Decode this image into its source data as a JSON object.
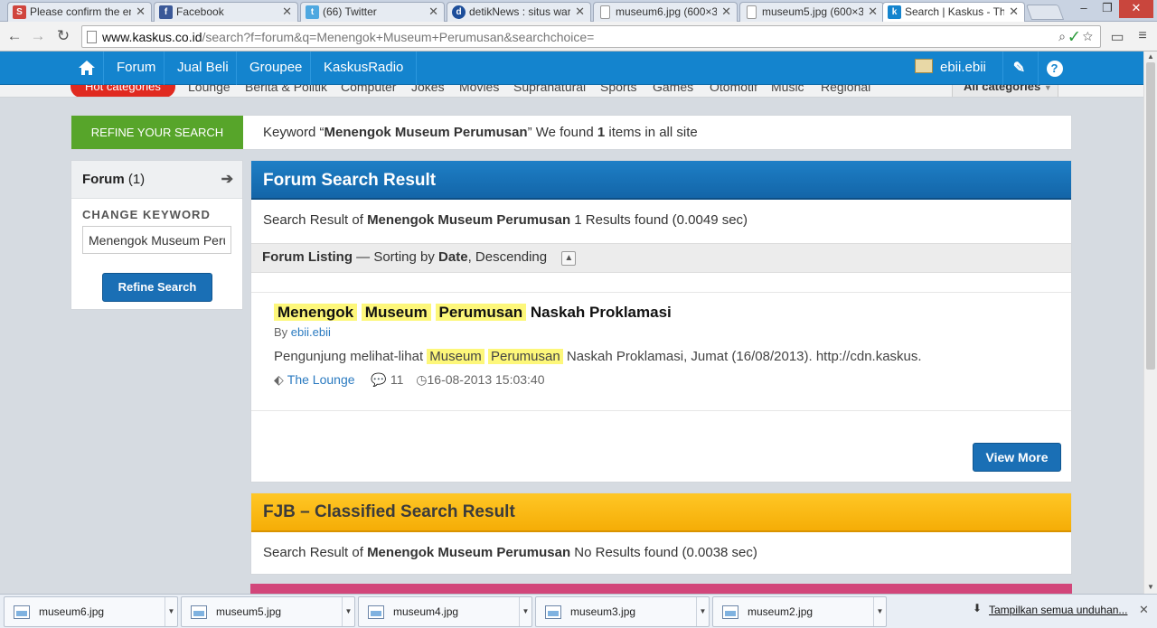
{
  "browser": {
    "tabs": [
      {
        "title": "Please confirm the em",
        "icon": "scribd-icon",
        "color": "#d0453e"
      },
      {
        "title": "Facebook",
        "icon": "facebook-icon",
        "color": "#3b5998"
      },
      {
        "title": "(66) Twitter",
        "icon": "twitter-icon",
        "color": "#4fa8e0"
      },
      {
        "title": "detikNews : situs wart",
        "icon": "detik-icon",
        "color": "#1d4e9a"
      },
      {
        "title": "museum6.jpg (600×3",
        "icon": "page-icon",
        "color": "#ffffff"
      },
      {
        "title": "museum5.jpg (600×3",
        "icon": "page-icon",
        "color": "#ffffff"
      },
      {
        "title": "Search | Kaskus - The",
        "icon": "kaskus-icon",
        "color": "#1484ce"
      }
    ],
    "url_host": "www.kaskus.co.id",
    "url_path": "/search?f=forum&q=Menengok+Museum+Perumusan&searchchoice="
  },
  "nav": {
    "items": [
      "Forum",
      "Jual Beli",
      "Groupee",
      "KaskusRadio"
    ],
    "username": "ebii.ebii",
    "accent": "#1484ce"
  },
  "categories": {
    "hot_label": "Hot categories",
    "items": [
      "Lounge",
      "Berita & Politik",
      "Computer",
      "Jokes",
      "Movies",
      "Supranatural",
      "Sports",
      "Games",
      "Otomotif",
      "Music",
      "Regional"
    ],
    "all_label": "All categories"
  },
  "refine": {
    "tag": "REFINE YOUR SEARCH",
    "keyword_prefix": "Keyword “",
    "keyword": "Menengok Museum Perumusan",
    "keyword_mid": "” We found ",
    "count": "1",
    "keyword_suffix": " items in all site"
  },
  "sidebar": {
    "forum_label": "Forum",
    "forum_count": "(1)",
    "change_keyword": "CHANGE KEYWORD",
    "input_value": "Menengok Museum Perumusan",
    "refine_button": "Refine Search"
  },
  "forum_result": {
    "header": "Forum Search Result",
    "summary_prefix": "Search Result of ",
    "summary_query": "Menengok Museum Perumusan",
    "summary_suffix": " 1 Results found (0.0049 sec)",
    "listing_label": "Forum Listing",
    "listing_sort_prefix": " — Sorting by ",
    "listing_sort_field": "Date",
    "listing_sort_order": ", Descending",
    "post": {
      "title_hl": [
        "Menengok",
        "Museum",
        "Perumusan"
      ],
      "title_rest": "Naskah Proklamasi",
      "by_prefix": "By ",
      "author": "ebii.ebii",
      "excerpt_before": "Pengunjung melihat-lihat ",
      "excerpt_hl": [
        "Museum",
        "Perumusan"
      ],
      "excerpt_after": " Naskah Proklamasi, Jumat (16/08/2013). http://cdn.kaskus.",
      "forum": "The Lounge",
      "replies": "11",
      "date": "16-08-2013 15:03:40"
    },
    "view_more": "View More"
  },
  "fjb_result": {
    "header": "FJB – Classified Search Result",
    "summary_prefix": "Search Result of ",
    "summary_query": "Menengok Museum Perumusan",
    "summary_suffix": "  No Results found (0.0038 sec)",
    "accent": "#f5ad06"
  },
  "downloads": {
    "files": [
      "museum6.jpg",
      "museum5.jpg",
      "museum4.jpg",
      "museum3.jpg",
      "museum2.jpg"
    ],
    "show_all": "Tampilkan semua unduhan..."
  }
}
